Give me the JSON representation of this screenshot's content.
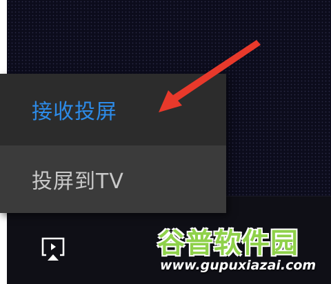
{
  "menu": {
    "items": [
      {
        "label": "接收投屏",
        "state": "highlighted"
      },
      {
        "label": "投屏到TV",
        "state": "hovered"
      }
    ]
  },
  "controls": {
    "cast_icon": "screen-cast-icon"
  },
  "annotation": {
    "arrow_icon": "red-pointer-arrow",
    "arrow_color": "#e8392b"
  },
  "watermark": {
    "title": "谷普软件园",
    "url": "www.gupuxiazai.com"
  },
  "colors": {
    "accent": "#2d8be8",
    "menu_bg": "#2c2c2c",
    "menu_hover_bg": "#3b3b3b",
    "watermark_green": "#8fd14a"
  }
}
